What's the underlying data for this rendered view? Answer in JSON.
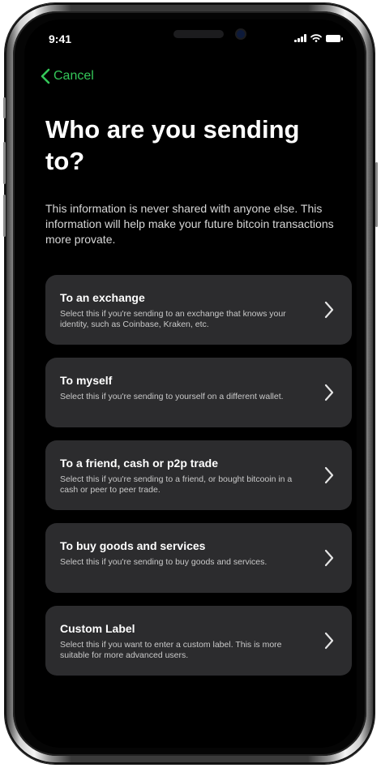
{
  "status_bar": {
    "time": "9:41"
  },
  "nav": {
    "cancel_label": "Cancel"
  },
  "header": {
    "title": "Who are you sending to?",
    "description": "This information is never shared with anyone else. This information will help make your future bitcoin transactions more provate."
  },
  "options": [
    {
      "title": "To an exchange",
      "description": "Select this if you're sending to an exchange that knows your identity, such as Coinbase, Kraken, etc."
    },
    {
      "title": "To myself",
      "description": "Select this if you're sending to yourself on a different wallet."
    },
    {
      "title": "To a friend, cash or p2p trade",
      "description": "Select this if you're sending to a friend, or bought bitcooin in a cash or peer to peer trade."
    },
    {
      "title": "To buy goods and services",
      "description": "Select this if you're sending to buy goods and services."
    },
    {
      "title": "Custom Label",
      "description": "Select this if you want to enter a custom label. This is more suitable for more advanced users."
    }
  ],
  "icons": {
    "back": "chevron-left-icon",
    "row": "chevron-right-icon",
    "signal": "cellular-signal-icon",
    "wifi": "wifi-icon",
    "battery": "battery-icon"
  },
  "colors": {
    "accent": "#34c759",
    "card": "#2c2c2e",
    "background": "#000000"
  }
}
